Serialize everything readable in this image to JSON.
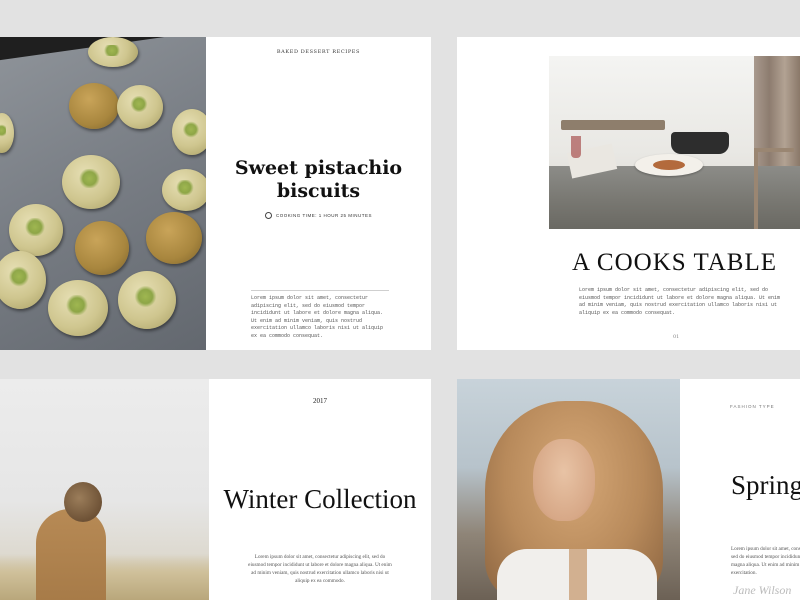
{
  "pistachio": {
    "kicker": "BAKED DESSERT RECIPES",
    "title": "Sweet pistachio biscuits",
    "cooking_time": "COOKING TIME: 1 HOUR 25 MINUTES",
    "body": "Lorem ipsum dolor sit amet, consectetur adipiscing elit, sed do eiusmod tempor incididunt ut labore et dolore magna aliqua. Ut enim ad minim veniam, quis nostrud exercitation ullamco laboris nisi ut aliquip ex ea commodo consequat."
  },
  "cooks_table": {
    "title": "A COOKS TABLE",
    "body": "Lorem ipsum dolor sit amet, consectetur adipiscing elit, sed do eiusmod tempor incididunt ut labore et dolore magna aliqua. Ut enim ad minim veniam, quis nostrud exercitation ullamco laboris nisi ut aliquip ex ea commodo consequat.",
    "page_number": "01"
  },
  "winter": {
    "year": "2017",
    "title": "Winter Collection",
    "body": "Lorem ipsum dolor sit amet, consectetur adipiscing elit, sed do eiusmod tempor incididunt ut labore et dolore magna aliqua. Ut enim ad minim veniam, quis nostrud exercitation ullamco laboris nisi ut aliquip ex ea commodo."
  },
  "spring": {
    "kicker": "FASHION TYPE",
    "title": "Spring Collection",
    "body": "Lorem ipsum dolor sit amet, consectetur adipiscing elit, sed do eiusmod tempor incididunt ut labore et dolore magna aliqua. Ut enim ad minim veniam, quis nostrud exercitation.",
    "signature": "Jane Wilson"
  }
}
